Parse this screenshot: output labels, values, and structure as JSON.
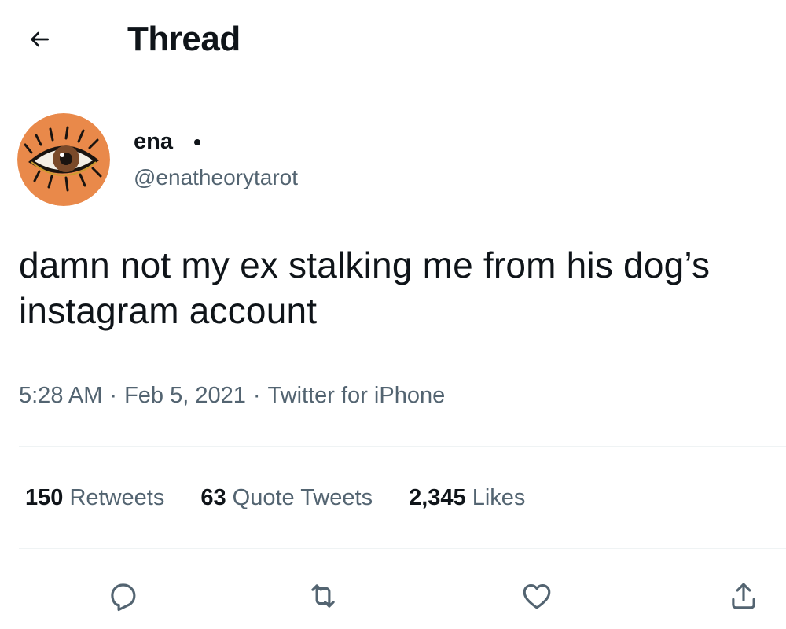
{
  "header": {
    "back_icon": "arrow-left-icon",
    "title": "Thread"
  },
  "author": {
    "display_name": "ena",
    "handle": "@enatheorytarot",
    "avatar_icon": "eye-avatar-icon"
  },
  "tweet": {
    "text": "damn not my ex stalking me from his dog’s instagram account",
    "time": "5:28 AM",
    "date": "Feb 5, 2021",
    "source": "Twitter for iPhone",
    "separator": "·"
  },
  "stats": {
    "retweets": {
      "count": "150",
      "label": "Retweets"
    },
    "quote_tweets": {
      "count": "63",
      "label": "Quote Tweets"
    },
    "likes": {
      "count": "2,345",
      "label": "Likes"
    }
  },
  "actions": [
    {
      "name": "reply",
      "icon": "reply-icon"
    },
    {
      "name": "retweet",
      "icon": "retweet-icon"
    },
    {
      "name": "like",
      "icon": "heart-icon"
    },
    {
      "name": "share",
      "icon": "share-icon"
    }
  ],
  "colors": {
    "text_primary": "#0f1419",
    "text_secondary": "#536471",
    "divider": "#eff3f4",
    "avatar_orange": "#e9894a"
  }
}
